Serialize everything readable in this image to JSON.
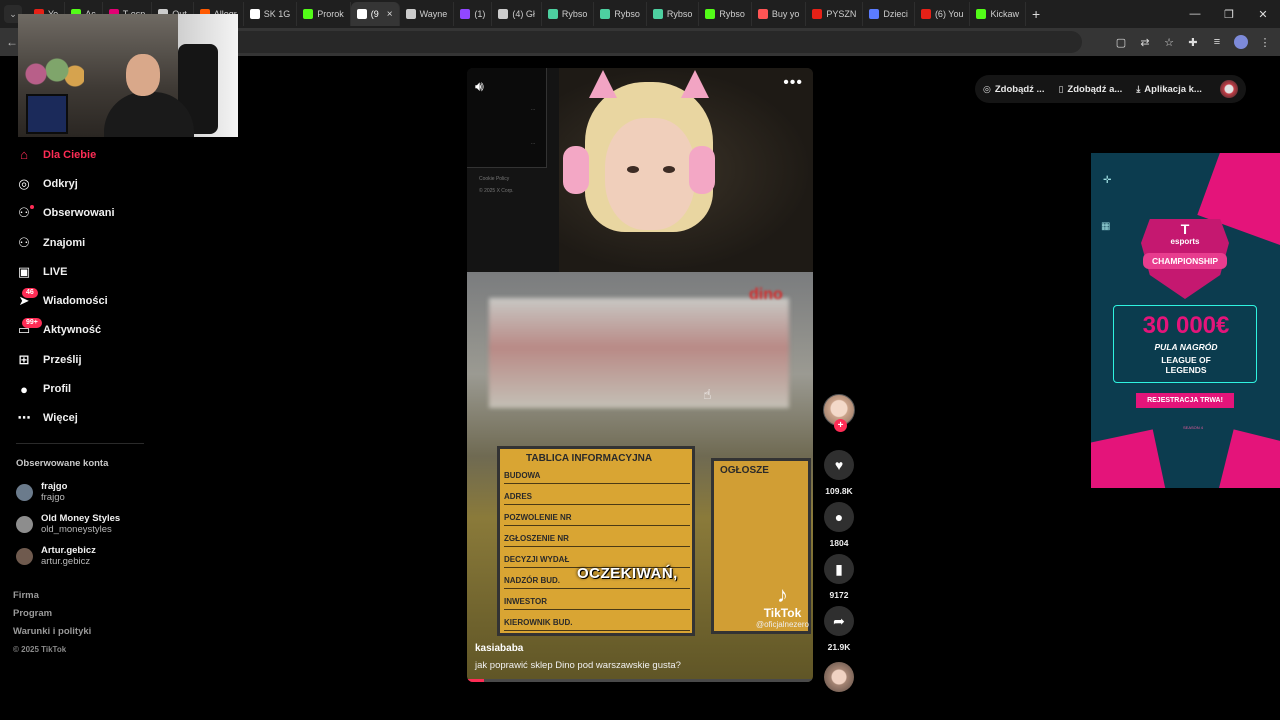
{
  "browser": {
    "tabs": [
      {
        "label": "Yo",
        "color": "#e62117"
      },
      {
        "label": "Ac",
        "color": "#53fc18"
      },
      {
        "label": "T-esp",
        "color": "#e20074"
      },
      {
        "label": "Out",
        "color": "#cccccc"
      },
      {
        "label": "Allegr",
        "color": "#ff5a00"
      },
      {
        "label": "SK 1G",
        "color": "#ffffff"
      },
      {
        "label": "Prorok",
        "color": "#53fc18"
      },
      {
        "label": "(9",
        "color": "#ffffff",
        "active": true
      },
      {
        "label": "Wayne",
        "color": "#cccccc"
      },
      {
        "label": "(1)",
        "color": "#9147ff"
      },
      {
        "label": "(4) Gł",
        "color": "#cccccc"
      },
      {
        "label": "Rybso",
        "color": "#4dd0a0"
      },
      {
        "label": "Rybso",
        "color": "#4dd0a0"
      },
      {
        "label": "Rybso",
        "color": "#4dd0a0"
      },
      {
        "label": "Rybso",
        "color": "#53fc18"
      },
      {
        "label": "Buy yo",
        "color": "#ff5555"
      },
      {
        "label": "PYSZN",
        "color": "#e62117"
      },
      {
        "label": "Dzieci",
        "color": "#5b7cff"
      },
      {
        "label": "(6) You",
        "color": "#e62117"
      },
      {
        "label": "Kickaw",
        "color": "#53fc18"
      }
    ],
    "new_tab": "+",
    "controls": {
      "minimize": "—",
      "restore": "❐",
      "close": "✕"
    }
  },
  "sidebar": {
    "nav": [
      {
        "label": "Dla Ciebie",
        "icon": "home-icon",
        "glyph": "⌂",
        "active": true
      },
      {
        "label": "Odkryj",
        "icon": "compass-icon",
        "glyph": "◎"
      },
      {
        "label": "Obserwowani",
        "icon": "user-following-icon",
        "glyph": "⚇",
        "dot": true
      },
      {
        "label": "Znajomi",
        "icon": "friends-icon",
        "glyph": "⚇"
      },
      {
        "label": "LIVE",
        "icon": "live-icon",
        "glyph": "▣"
      },
      {
        "label": "Wiadomości",
        "icon": "messages-icon",
        "glyph": "➤",
        "badge": "46"
      },
      {
        "label": "Aktywność",
        "icon": "activity-icon",
        "glyph": "▭",
        "badge": "99+"
      },
      {
        "label": "Prześlij",
        "icon": "upload-icon",
        "glyph": "⊞"
      },
      {
        "label": "Profil",
        "icon": "profile-icon",
        "glyph": "●"
      },
      {
        "label": "Więcej",
        "icon": "more-icon",
        "glyph": "⋯"
      }
    ],
    "following_title": "Obserwowane konta",
    "accounts": [
      {
        "name": "frajgo",
        "handle": "frajgo",
        "color": "#6b7b8c"
      },
      {
        "name": "Old Money Styles",
        "handle": "old_moneystyles",
        "color": "#8d8d8d"
      },
      {
        "name": "Artur.gebicz",
        "handle": "artur.gebicz",
        "color": "#6f5a4e"
      }
    ],
    "footer": [
      "Firma",
      "Program",
      "Warunki i polityki"
    ],
    "copyright": "© 2025 TikTok"
  },
  "video": {
    "screen_text_1": "Cookie Policy",
    "screen_text_2": "© 2025 X Corp.",
    "board1_title": "TABLICA INFORMACYJNA",
    "board1_rows": [
      "BUDOWA",
      "ADRES",
      "POZWOLENIE NR",
      "ZGŁOSZENIE NR",
      "DECYZJI WYDAŁ",
      "NADZÓR BUD.",
      "INWESTOR",
      "KIEROWNIK BUD."
    ],
    "board2_title": "OGŁOSZE",
    "store_logo": "dino",
    "caption": "OCZEKIWAŃ,",
    "watermark_name": "TikTok",
    "watermark_user": "@oficjalnezero",
    "author": "kasiababa",
    "description": "jak poprawić sklep Dino pod warszawskie gusta?",
    "progress": 0.05
  },
  "actions": {
    "likes": "109.8K",
    "comments": "1804",
    "saves": "9172",
    "shares": "21.9K"
  },
  "top_pills": [
    {
      "label": "Zdobądź ...",
      "icon": "coin-icon",
      "glyph": "◎"
    },
    {
      "label": "Zdobądź a...",
      "icon": "phone-icon",
      "glyph": "▯"
    },
    {
      "label": "Aplikacja k...",
      "icon": "download-icon",
      "glyph": "⤓"
    }
  ],
  "ad": {
    "brand": "T",
    "brand_sub": "esports",
    "event": "CHAMPIONSHIP",
    "prize": "30 000€",
    "prize_label": "PULA NAGRÓD",
    "game_line1": "LEAGUE OF",
    "game_line2": "LEGENDS",
    "cta": "REJESTRACJA TRWA!",
    "fine_print": "SEASON 4"
  }
}
